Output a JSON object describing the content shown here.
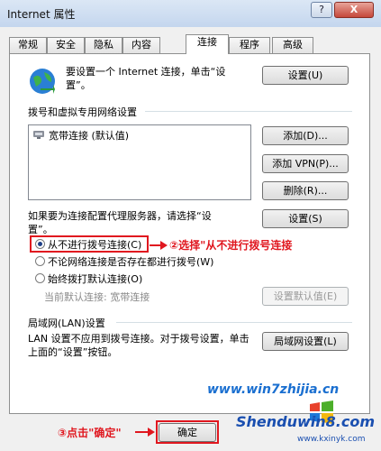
{
  "window": {
    "title": "Internet 属性",
    "help_label": "?",
    "close_label": "X"
  },
  "tabs": [
    "常规",
    "安全",
    "隐私",
    "内容",
    "连接",
    "程序",
    "高级"
  ],
  "active_tab": "连接",
  "setup": {
    "text": "要设置一个 Internet 连接，单击“设置”。",
    "button": "设置(U)"
  },
  "dialup": {
    "section_label": "拨号和虚拟专用网络设置",
    "connections": [
      "宽带连接 (默认值)"
    ],
    "add_button": "添加(D)...",
    "add_vpn_button": "添加 VPN(P)...",
    "remove_button": "删除(R)...",
    "proxy_text": "如果要为连接配置代理服务器，请选择“设置”。",
    "settings_button": "设置(S)",
    "options": [
      {
        "label": "从不进行拨号连接(C)",
        "selected": true
      },
      {
        "label": "不论网络连接是否存在都进行拨号(W)",
        "selected": false
      },
      {
        "label": "始终拨打默认连接(O)",
        "selected": false
      }
    ],
    "current_default_label": "当前默认连接:",
    "current_default_value": "宽带连接",
    "set_default_button": "设置默认值(E)"
  },
  "lan": {
    "section_label": "局域网(LAN)设置",
    "text": "LAN 设置不应用到拨号连接。对于拨号设置，单击上面的“设置”按钮。",
    "button": "局域网设置(L)"
  },
  "footer": {
    "ok_button": "确定"
  },
  "annotations": {
    "step2": "②选择\"从不进行拨号连接",
    "step3": "③点击\"确定\""
  },
  "watermark": {
    "site1": "www.win7zhijia.cn",
    "brand": "Shenduwin8.com",
    "site2": "www.kxinyk.com"
  },
  "colors": {
    "annotation": "#e0171f",
    "titlebar": "#c4d6ee",
    "watermark": "#1a6fd0"
  }
}
